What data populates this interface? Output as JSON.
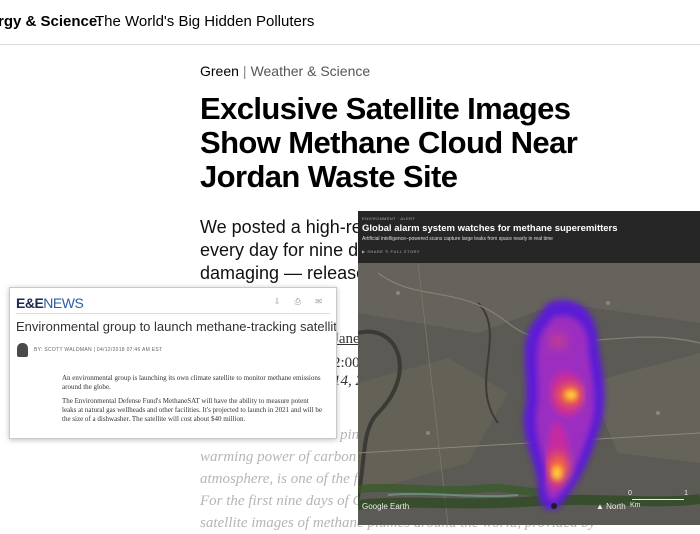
{
  "topbar": {
    "section": "rgy & Science:",
    "title": "The World's Big Hidden Polluters"
  },
  "article": {
    "kicker_primary": "Green",
    "kicker_separator": "|",
    "kicker_category": "Weather & Science",
    "headline_lines": [
      "Exclusive Satellite Images",
      "Show Methane Cloud Near",
      "Jordan Waste Site"
    ],
    "dek_lines": [
      "We posted a high-re",
      "every day for nine da",
      "damaging — release"
    ],
    "byline_author": "Jane",
    "byline_time": "2:00",
    "byline_date": "14, 2",
    "faded_lines": [
      "ping em",
      "warming power of carbon",
      "atmosphere, is one of the f",
      "For the first nine days of C",
      "satellite images of methane plumes around the world, provided by"
    ]
  },
  "eenews": {
    "logo_ee": "E&E",
    "logo_news": "NEWS",
    "tools": "⇩ ⎙ ✉",
    "title": "Environmental group to launch methane-tracking satellite",
    "meta": "BY: SCOTT WALDMAN | 04/12/2018 07:46 AM EST",
    "paragraphs": [
      "An environmental group is launching its own climate satellite to monitor methane emissions around the globe.",
      "The Environmental Defense Fund's MethaneSAT will have the ability to measure potent leaks at natural gas wellheads and other facilities. It's projected to launch in 2021 and will be the size of a dishwasher. The satellite will cost about $40 million."
    ]
  },
  "satellite": {
    "tiny_label": "ENVIRONMENT  ·  ALERT",
    "title": "Global alarm system watches for methane superemitters",
    "dek": "Artificial intelligence–powered scans capture large leaks from space nearly in real time",
    "share": "▶ SHARE   ✎ FULL STORY",
    "watermark": "Google Earth",
    "north": "▲ North",
    "scale_start": "0",
    "scale_end": "1",
    "scale_unit": "Km",
    "colors": {
      "plume_core": "#ffd23a",
      "plume_mid": "#ff7a1a",
      "plume_outer": "#c62aa0",
      "plume_edge": "#5b1fd4"
    }
  }
}
